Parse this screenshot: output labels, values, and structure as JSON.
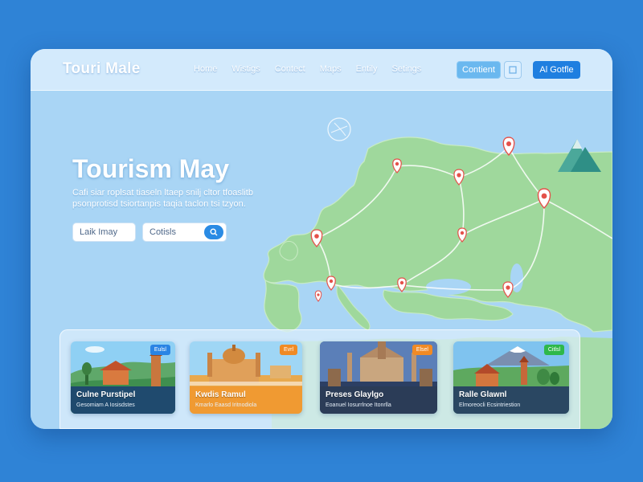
{
  "header": {
    "brand": "Touri Male",
    "nav": [
      "Home",
      "Wistigs",
      "Contect",
      "Maps",
      "Entily",
      "Setings"
    ],
    "contact_button": "Contient",
    "primary_button": "Al Gotfle"
  },
  "hero": {
    "title": "Tourism May",
    "subtitle": "Cafi siar roplsat tiaseln ltaep snilj cltor tfoaslitb psonprotisd tsiortanpis taqia taclon tsi tzyon.",
    "input1_value": "Laik Imay",
    "input2_value": "Cotisls"
  },
  "cards": [
    {
      "title": "Culne Purstipel",
      "text": "Gesomiam A Iosisdstes",
      "badge": "Eulsl",
      "badge_color": "#2a84e4"
    },
    {
      "title": "Kwdis Ramul",
      "text": "Kmarlo Eaasd Iritnodiola",
      "badge": "Evrl",
      "badge_color": "#f08a24"
    },
    {
      "title": "Preses Glaylgo",
      "text": "Eoanuel Iosurrlnoe Itonrlla",
      "badge": "Elsel",
      "badge_color": "#f08a24"
    },
    {
      "title": "Ralle Glawnl",
      "text": "Elmoreocli Ecsintriestion",
      "badge": "Citlsl",
      "badge_color": "#2eb84a"
    }
  ],
  "colors": {
    "background": "#2f83d6",
    "sea": "#a8d4f4",
    "land": "#9fd89c",
    "primary": "#1f7fe0",
    "pin": "#e4514a"
  },
  "icons": {
    "search": "search-icon",
    "compass": "compass-icon",
    "pin": "map-pin-icon",
    "mountain": "mountain-icon"
  }
}
